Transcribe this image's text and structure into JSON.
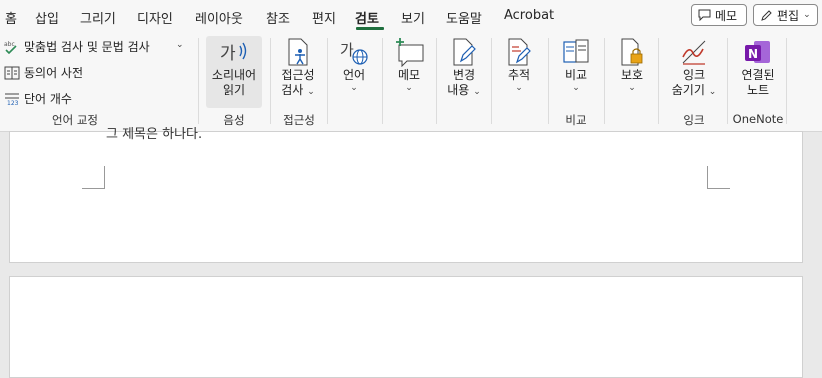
{
  "menu": {
    "tabs": [
      "홈",
      "삽입",
      "그리기",
      "디자인",
      "레이아웃",
      "참조",
      "편지",
      "검토",
      "보기",
      "도움말",
      "Acrobat"
    ],
    "active_tab": "검토",
    "comment_button": "메모",
    "edit_button": "편집"
  },
  "ribbon": {
    "proofing": {
      "spell_check": "맞춤법 검사 및 문법 검사",
      "thesaurus": "동의어 사전",
      "word_count": "단어 개수",
      "label": "언어 교정"
    },
    "speech": {
      "read_aloud_line1": "소리내어",
      "read_aloud_line2": "읽기",
      "label": "음성"
    },
    "accessibility": {
      "check_line1": "접근성",
      "check_line2": "검사",
      "label": "접근성"
    },
    "language": {
      "language": "언어"
    },
    "comments": {
      "comment": "메모"
    },
    "tracking": {
      "changes_line1": "변경",
      "changes_line2": "내용",
      "track": "추적"
    },
    "compare": {
      "compare": "비교",
      "label": "비교"
    },
    "protect": {
      "protect": "보호"
    },
    "ink": {
      "hide_line1": "잉크",
      "hide_line2": "숨기기",
      "label": "잉크"
    },
    "onenote": {
      "linked_line1": "연결된",
      "linked_line2": "노트",
      "label": "OneNote"
    }
  },
  "document": {
    "partial_text": "그 제목은 하나다."
  },
  "colors": {
    "accent_green": "#1f6f3e",
    "onenote_purple": "#7719aa"
  },
  "icons": [
    "spellcheck-icon",
    "thesaurus-icon",
    "word-count-icon",
    "read-aloud-icon",
    "accessibility-icon",
    "language-icon",
    "new-comment-icon",
    "track-changes-icon",
    "tracking-icon",
    "compare-icon",
    "protect-icon",
    "hide-ink-icon",
    "onenote-icon",
    "comment-icon",
    "pencil-icon"
  ]
}
